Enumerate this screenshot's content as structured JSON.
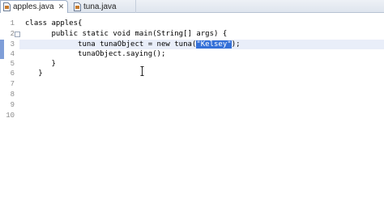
{
  "tabs": [
    {
      "label": "apples.java",
      "close": "✕"
    },
    {
      "label": "tuna.java"
    }
  ],
  "line_numbers": [
    "1",
    "2",
    "3",
    "4",
    "5",
    "6",
    "7",
    "8",
    "9",
    "10"
  ],
  "code": {
    "line1": "class apples{",
    "line2": "      public static void main(String[] args) {",
    "line3_before": "            tuna tunaObject = new tuna(",
    "line3_selected": "\"Kelsey\"",
    "line3_after": ");",
    "line4": "            tunaObject.saying();",
    "line5": "      }",
    "line6": "   }"
  },
  "colors": {
    "selection": "#3470d8",
    "marker": "#7f9ed8"
  },
  "icons": {
    "file": "java-file-icon",
    "cursor": "ibeam-cursor-icon"
  }
}
